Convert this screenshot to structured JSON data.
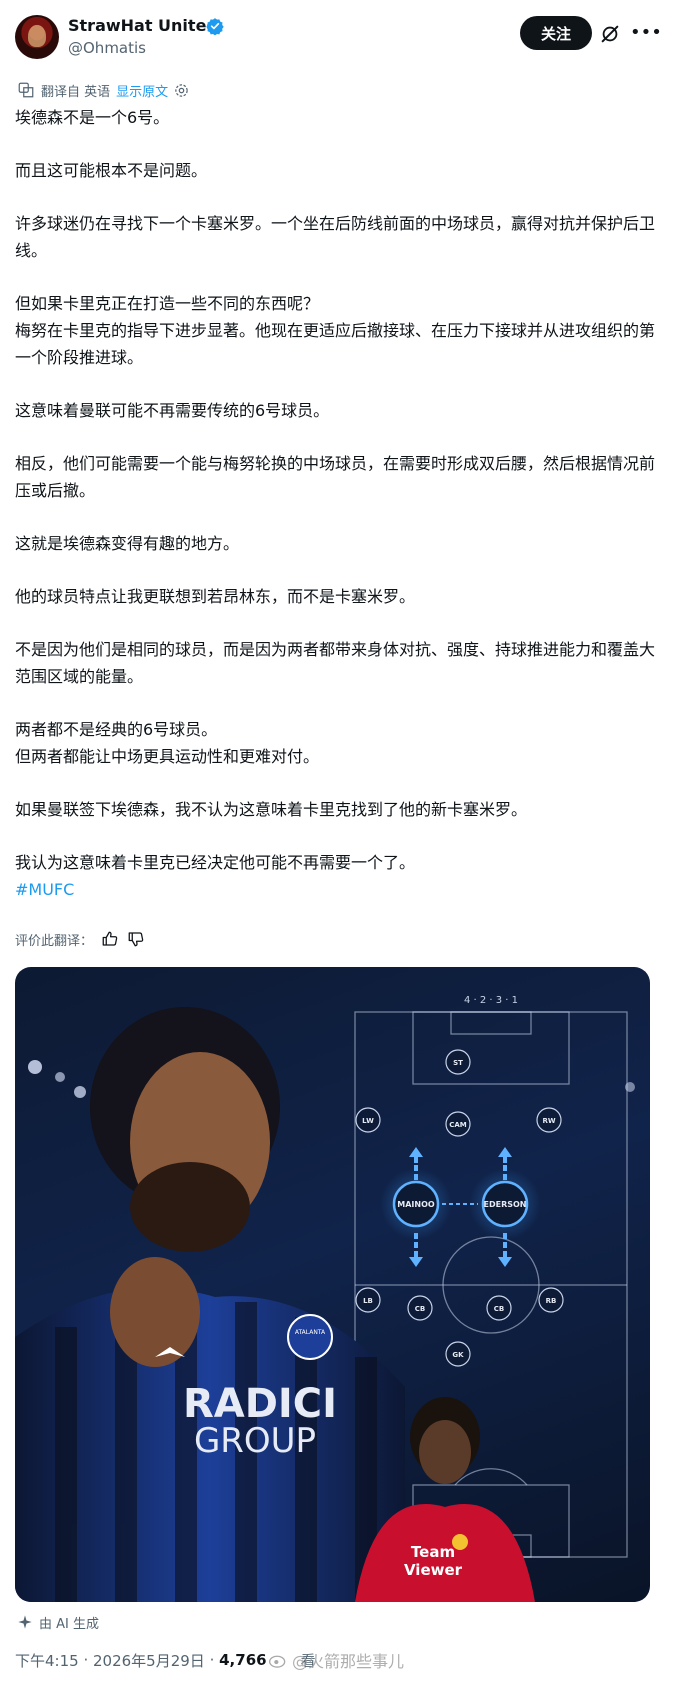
{
  "author": {
    "display_name": "StrawHat United",
    "handle": "@Ohmatis",
    "verified_icon": "verified-badge-icon"
  },
  "actions": {
    "follow_label": "关注",
    "grok_icon": "grok-icon",
    "more_icon": "more-icon"
  },
  "translation": {
    "label": "翻译自 英语",
    "show_original": "显示原文"
  },
  "tweet": {
    "paragraphs": [
      "埃德森不是一个6号。",
      "而且这可能根本不是问题。",
      "许多球迷仍在寻找下一个卡塞米罗。一个坐在后防线前面的中场球员，赢得对抗并保护后卫线。",
      "但如果卡里克正在打造一些不同的东西呢？\n梅努在卡里克的指导下进步显著。他现在更适应后撤接球、在压力下接球并从进攻组织的第一个阶段推进球。",
      "这意味着曼联可能不再需要传统的6号球员。",
      "相反，他们可能需要一个能与梅努轮换的中场球员，在需要时形成双后腰，然后根据情况前压或后撤。",
      "这就是埃德森变得有趣的地方。",
      "他的球员特点让我更联想到若昂林东，而不是卡塞米罗。",
      "不是因为他们是相同的球员，而是因为两者都带来身体对抗、强度、持球推进能力和覆盖大范围区域的能量。",
      "两者都不是经典的6号球员。\n但两者都能让中场更具运动性和更难对付。",
      "如果曼联签下埃德森，我不认为这意味着卡里克找到了他的新卡塞米罗。",
      "我认为这意味着卡里克已经决定他可能不再需要一个了。"
    ],
    "hashtag": "#MUFC"
  },
  "rate_translation": {
    "label": "评价此翻译："
  },
  "media": {
    "formation": "4 · 2 · 3 · 1",
    "positions": [
      "ST",
      "LW",
      "CAM",
      "RW",
      "MAINOO",
      "EDERSON",
      "LB",
      "CB",
      "CB",
      "RB",
      "GK"
    ],
    "shirt_sponsor_line1": "RADICI",
    "shirt_sponsor_line2": "GROUP",
    "club_crest_text": "ATALANTA",
    "mu_sponsor_line1": "Team",
    "mu_sponsor_line2": "Viewer"
  },
  "ai_label": "由 AI 生成",
  "meta": {
    "time": "下午4:15",
    "date": "2026年5月29日",
    "views": "4,766",
    "views_suffix": "看"
  },
  "watermark": "@火箭那些事儿"
}
